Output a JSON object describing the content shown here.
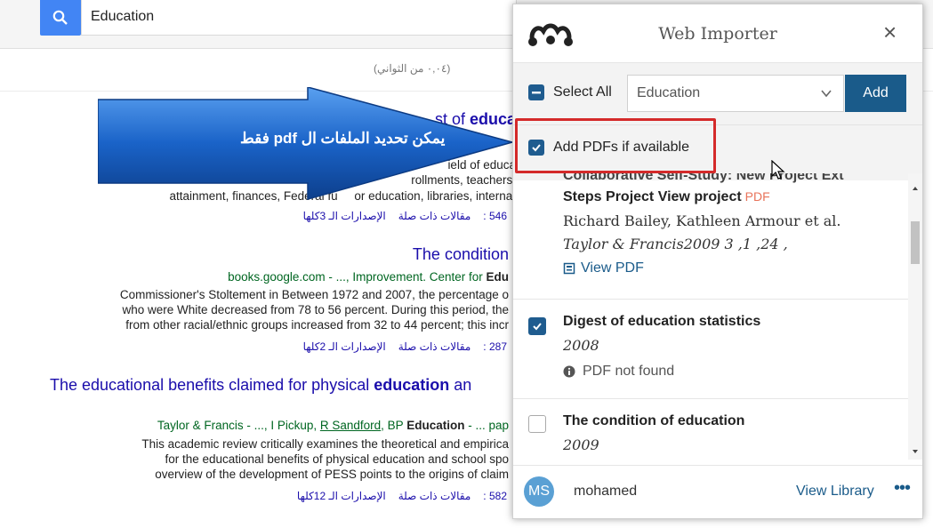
{
  "scholar": {
    "search_value": "Education",
    "stats": "(٠,٠٤ من الثواني)",
    "results": [
      {
        "title_tail": "st of ",
        "title_bold": "educa",
        "snippet_partial_1": "ield of educa",
        "snippet_partial_2": "rollments, teachers,",
        "snippet_line": "attainment, finances, Federal fu     or education, libraries, internat",
        "links": [
          "546 :",
          "مقالات ذات صلة",
          "الإصدارات الـ 3كلها"
        ]
      },
      {
        "title": "The condition",
        "source_pre": "books.google.com - ..., Improvement. Center for ",
        "source_bold": "Edu",
        "snippet_lines": [
          "Commissioner's Stoltement in Between 1972 and 2007, the percentage o",
          "who were White decreased from 78 to 56 percent. During this period, the",
          "from other racial/ethnic groups increased from 32 to 44 percent; this incr"
        ],
        "links": [
          "287 :",
          "مقالات ذات صلة",
          "الإصدارات الـ 2كلها"
        ]
      },
      {
        "title_pre": "The educational benefits claimed for physical ",
        "title_bold": "education",
        "title_post": " an",
        "source_pre": "Taylor & Francis - ..., I Pickup, ",
        "source_link": "R Sandford",
        "source_mid": ", BP ",
        "source_bold": "Education",
        "source_post": " - ... pap",
        "snippet_lines": [
          "This academic review critically examines the theoretical and empirica",
          "for the educational benefits of physical education and school spo",
          "overview of the development of PESS points to the origins of claim"
        ],
        "links": [
          "582 :",
          "مقالات ذات صلة",
          "الإصدارات الـ 12كلها"
        ]
      }
    ]
  },
  "annotation": {
    "arrow_text": "يمكن تحديد الملفات ال  pdf فقط",
    "arrow_color": "#1a63c8"
  },
  "importer": {
    "title": "Web Importer",
    "select_all_label": "Select All",
    "folder_value": "Education",
    "add_label": "Add",
    "add_pdfs_label": "Add PDFs if available",
    "items": [
      {
        "title_top": "Collaborative Self-Study: New Project Ext",
        "title": "Steps Project View project",
        "pdf_tag": "PDF",
        "authors": "Richard Bailey, Kathleen Armour et al.",
        "meta": "Taylor & Francis2009 3 ,1 ,24 ,",
        "view_pdf": "View PDF",
        "checked": false
      },
      {
        "title": "Digest of education statistics",
        "year": "2008",
        "status": "PDF not found",
        "checked": true
      },
      {
        "title": "The condition of education",
        "year": "2009",
        "checked": false
      }
    ],
    "user_initials": "MS",
    "user_name": "mohamed",
    "view_library": "View Library",
    "more": "•••",
    "accent": "#1a5b8a"
  }
}
